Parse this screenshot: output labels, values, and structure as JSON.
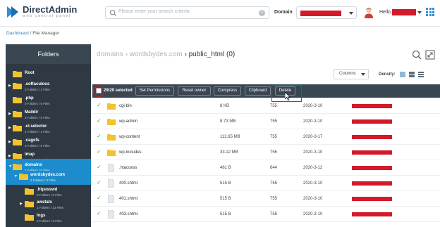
{
  "app": {
    "title": "DirectAdmin",
    "subtitle": "web control panel"
  },
  "search": {
    "placeholder": "Please enter your search criteria"
  },
  "header": {
    "domain_label": "Domain",
    "hello_label": "Hello,"
  },
  "breadcrumb": {
    "dashboard": "Dashboard",
    "separator": " / ",
    "current": "File Manager"
  },
  "sidebar": {
    "title": "Folders",
    "items": [
      {
        "name": "Root",
        "sub": ""
      },
      {
        "name": ".softaculous",
        "sub": "3 Folders / 3 Files"
      },
      {
        "name": ".php",
        "sub": "0 Folders / 6 Files"
      },
      {
        "name": "Maildir",
        "sub": "3 Folders / 0 Files"
      },
      {
        "name": ".cl.selector",
        "sub": "1 Folders / 1 Files"
      },
      {
        "name": ".cagefs",
        "sub": "3 Folders / 0 Files"
      },
      {
        "name": "imap",
        "sub": "1 Folders / 0 Files"
      },
      {
        "name": "domains",
        "sub": "1 Folders / 0 Files"
      },
      {
        "name": "wordsbydes.com",
        "sub": "2 Folders / 0 Files"
      },
      {
        "name": ".htpasswd",
        "sub": "0 Folders / 0 Files"
      },
      {
        "name": "awstats",
        "sub": "1 Folders / 23 Files"
      },
      {
        "name": "logs",
        "sub": "0 Folders / 0 Files"
      }
    ]
  },
  "main": {
    "path": {
      "root": "domains",
      "sep": " › ",
      "domain": "wordsbydes.com",
      "current": "public_html",
      "count": "(0)"
    },
    "columns_label": "Columns",
    "density_label": "Density:",
    "toolbar": {
      "selected": "29/29 selected",
      "set_permissions": "Set Permissions",
      "reset_owner": "Reset owner",
      "compress": "Compress",
      "clipboard": "Clipboard",
      "delete": "Delete"
    },
    "files": [
      {
        "name": "cgi-bin",
        "size": "8 KB",
        "perm": "755",
        "date": "2020-3-10",
        "type": "folder"
      },
      {
        "name": "wp-admin",
        "size": "8.73 MB",
        "perm": "755",
        "date": "2020-3-10",
        "type": "folder"
      },
      {
        "name": "wp-content",
        "size": "112.65 MB",
        "perm": "755",
        "date": "2020-3-17",
        "type": "folder"
      },
      {
        "name": "wp-includes",
        "size": "33.12 MB",
        "perm": "755",
        "date": "2020-3-10",
        "type": "folder"
      },
      {
        "name": ".htaccess",
        "size": "461 B",
        "perm": "644",
        "date": "2020-3-12",
        "type": "file"
      },
      {
        "name": "400.shtml",
        "size": "515 B",
        "perm": "755",
        "date": "2020-3-10",
        "type": "file"
      },
      {
        "name": "401.shtml",
        "size": "515 B",
        "perm": "755",
        "date": "2020-3-10",
        "type": "file"
      },
      {
        "name": "403.shtml",
        "size": "515 B",
        "perm": "755",
        "date": "2020-3-10",
        "type": "file"
      }
    ]
  },
  "colors": {
    "brand": "#2d8fd5",
    "sidebar": "#2e3943",
    "selected": "#1d8ccc",
    "redaction": "#d41a2a"
  }
}
